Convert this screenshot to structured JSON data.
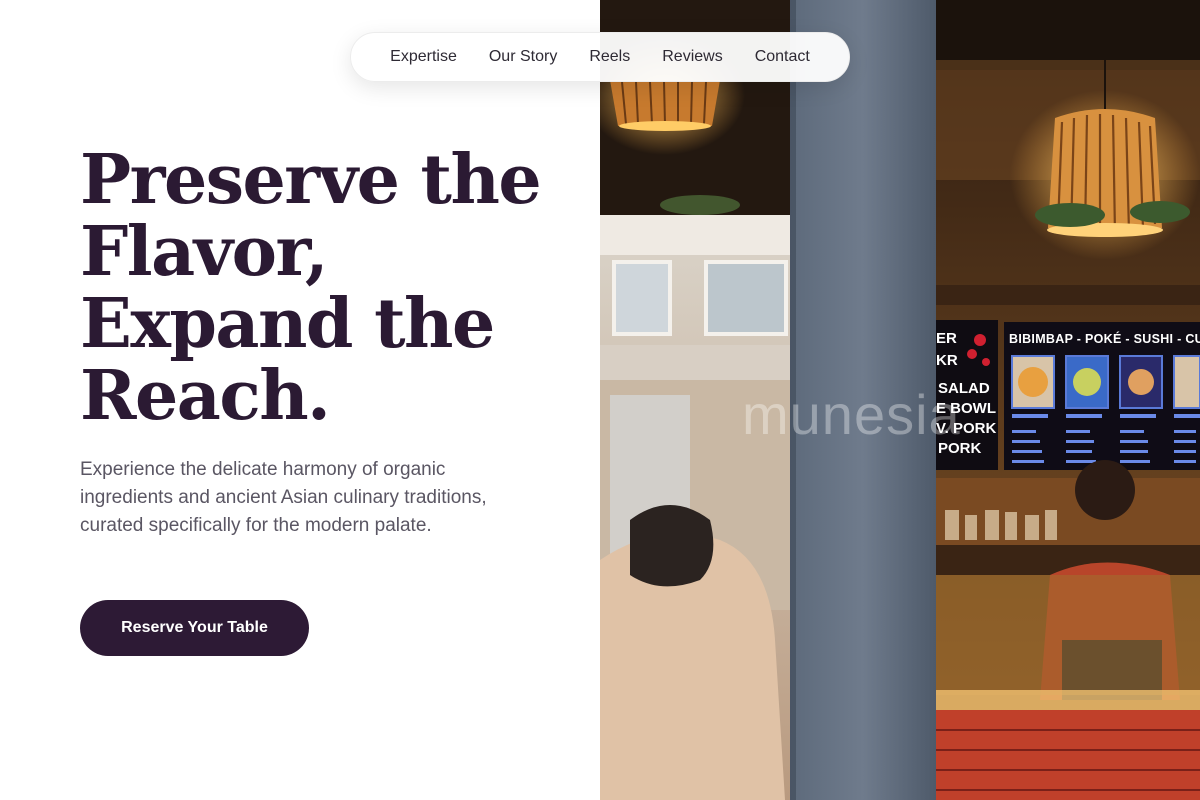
{
  "nav": {
    "items": [
      "Expertise",
      "Our Story",
      "Reels",
      "Reviews",
      "Contact"
    ]
  },
  "hero": {
    "headline_lines": [
      "Preserve the",
      "Flavor,",
      "Expand the",
      "Reach."
    ],
    "subtext": "Experience the delicate harmony of organic ingredients and ancient Asian culinary traditions, curated specifically for the modern palate.",
    "cta_label": "Reserve Your Table"
  },
  "photo": {
    "watermark": "munesia",
    "menu_title": "BIBIMBAP - POKÉ - SUSHI - CURRY",
    "menu_left_items": [
      "ER",
      "KR",
      "SALAD",
      "E BOWL",
      "V. PORK",
      "PORK"
    ]
  },
  "colors": {
    "headline": "#2b1a33",
    "cta_background": "#2d1a35",
    "body_text": "#5a5663"
  }
}
